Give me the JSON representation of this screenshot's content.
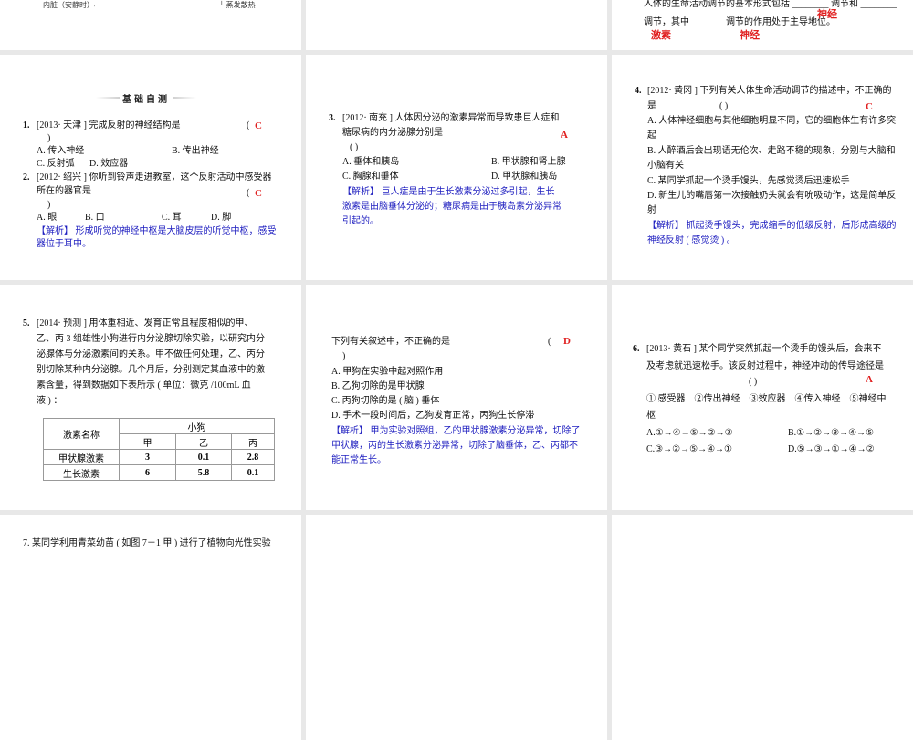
{
  "slides": {
    "s0": {
      "line1": "内脏（安静时）⌐",
      "line2": "└ 蒸发散热"
    },
    "s2": {
      "line1": "人体的生命活动调节的基本形式包括 ________ 调节和 ________",
      "line2": "调节，其中 _______ 调节的作用处于主导地位。",
      "answers": [
        "激素",
        "神经",
        "神经"
      ]
    },
    "s3": {
      "banner": "基础自测",
      "q1": {
        "num": "1.",
        "text": "[2013· 天津 ] 完成反射的神经结构是",
        "paren_open": "(",
        "paren_close": ")",
        "answer": "C",
        "options": [
          "A. 传入神经",
          "B. 传出神经",
          "C. 反射弧",
          "D. 效应器"
        ]
      },
      "q2": {
        "num": "2.",
        "text1": "[2012· 绍兴 ] 你听到铃声走进教室，这个反射活动中感受器",
        "text2": "所在的器官是",
        "paren_open": "(",
        "paren_close": ")",
        "answer": "C",
        "options": [
          "A. 眼",
          "B. 口",
          "C. 耳",
          "D. 脚"
        ],
        "analysis1": "【解析】 形成听觉的神经中枢是大脑皮层的听觉中枢，感受",
        "analysis2": "器位于耳中。"
      }
    },
    "s4": {
      "num": "3.",
      "text1": "[2012· 南充 ] 人体因分泌的激素异常而导致患巨人症和",
      "text2": "糖尿病的内分泌腺分别是",
      "paren": "(          )",
      "answer": "A",
      "options": [
        "A. 垂体和胰岛",
        "B. 甲状腺和肾上腺",
        "C. 胸腺和垂体",
        "D. 甲状腺和胰岛"
      ],
      "analysis": [
        "【解析】 巨人症是由于生长激素分泌过多引起，生长",
        "激素是由脑垂体分泌的；糖尿病是由于胰岛素分泌异常",
        "引起的。"
      ]
    },
    "s5": {
      "num": "4.",
      "text1": "[2012· 黄冈 ] 下列有关人体生命活动调节的描述中，不正确的",
      "text2": "是",
      "paren": "(          )",
      "answer": "C",
      "lines": [
        "A. 人体神经细胞与其他细胞明显不同，它的细胞体生有许多突",
        "起",
        "B. 人醉酒后会出现语无伦次、走路不稳的现象，分别与大脑和",
        "小脑有关",
        "C. 某同学抓起一个烫手馒头，先感觉烫后迅速松手",
        "D. 新生儿的嘴唇第一次接触奶头就会有吮吸动作，这是简单反",
        "射"
      ],
      "analysis": [
        "【解析】 抓起烫手馒头，完成缩手的低级反射，后形成高级的",
        "神经反射 ( 感觉烫 ) 。"
      ]
    },
    "s6": {
      "num": "5.",
      "lines": [
        "[2014· 预测 ] 用体重相近、发育正常且程度相似的甲、",
        "乙、丙 3 组雄性小狗进行内分泌腺切除实验，以研究内分",
        "泌腺体与分泌激素间的关系。甲不做任何处理，乙、丙分",
        "别切除某种内分泌腺。几个月后，分别测定其血液中的激",
        "素含量，得到数据如下表所示 ( 单位：微克 /100mL 血",
        "液 ) ："
      ],
      "table": {
        "header_name": "激素名称",
        "header_group": "小狗",
        "columns": [
          "甲",
          "乙",
          "丙"
        ],
        "rows": [
          {
            "name": "甲状腺激素",
            "values": [
              "3",
              "0.1",
              "2.8"
            ]
          },
          {
            "name": "生长激素",
            "values": [
              "6",
              "5.8",
              "0.1"
            ]
          }
        ]
      }
    },
    "s7": {
      "text": "下列有关叙述中，不正确的是",
      "paren_open": "(",
      "paren_close": ")",
      "answer": "D",
      "options": [
        "A. 甲狗在实验中起对照作用",
        "B. 乙狗切除的是甲状腺",
        "C. 丙狗切除的是 ( 脑 ) 垂体",
        "D. 手术一段时间后，乙狗发育正常，丙狗生长停滞"
      ],
      "analysis": [
        "【解析】 甲为实验对照组，乙的甲状腺激素分泌异常，切除了",
        "甲状腺，丙的生长激素分泌异常，切除了脑垂体，乙、丙都不",
        "能正常生长。"
      ]
    },
    "s8": {
      "num": "6.",
      "text1": "[2013· 黄石 ] 某个同学突然抓起一个烫手的馒头后，会来不",
      "text2": "及考虑就迅速松手。该反射过程中，神经冲动的传导途径是",
      "paren": "(          )",
      "answer": "A",
      "items1": "① 感受器　②传出神经　③效应器　④传入神经　⑤神经中",
      "items2": "枢",
      "options": [
        "A.①→④→⑤→②→③",
        "B.①→②→③→④→⑤",
        "C.③→②→⑤→④→①",
        "D.⑤→③→①→④→②"
      ]
    },
    "s9": {
      "text": "7.  某同学利用青菜幼苗 ( 如图 7－1 甲 ) 进行了植物向光性实验"
    }
  }
}
